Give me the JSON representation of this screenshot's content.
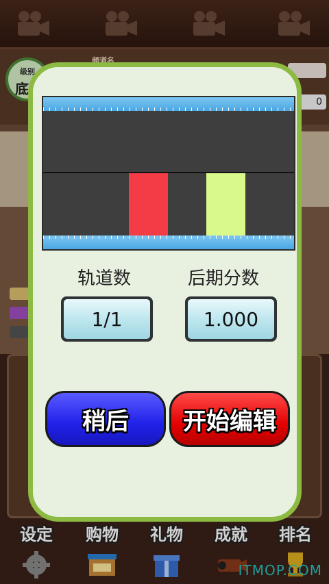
{
  "background": {
    "level_label": "级别",
    "level_value": "底",
    "name_label": "频道名",
    "score_value": "0",
    "camera_icons": [
      "movie-camera-icon",
      "movie-camera-icon",
      "movie-camera-icon",
      "movie-camera-icon"
    ],
    "tabs": [
      {
        "label": "设定",
        "icon": "gear-icon"
      },
      {
        "label": "购物",
        "icon": "shop-icon"
      },
      {
        "label": "礼物",
        "icon": "gift-icon"
      },
      {
        "label": "成就",
        "icon": "film-reel-icon"
      },
      {
        "label": "排名",
        "icon": "trophy-icon"
      }
    ],
    "watermark": "ITMOP.COM"
  },
  "dialog": {
    "tracks_label": "轨道数",
    "tracks_value": "1/1",
    "post_score_label": "后期分数",
    "post_score_value": "1.000",
    "later_button": "稍后",
    "start_button": "开始编辑",
    "note_colors": [
      "#f43c46",
      "#d9f98a"
    ]
  },
  "colors": {
    "dialog_border": "#8cba42",
    "dialog_bg": "#e8f0e0",
    "later_button": "#2020e8",
    "start_button": "#e40000"
  }
}
